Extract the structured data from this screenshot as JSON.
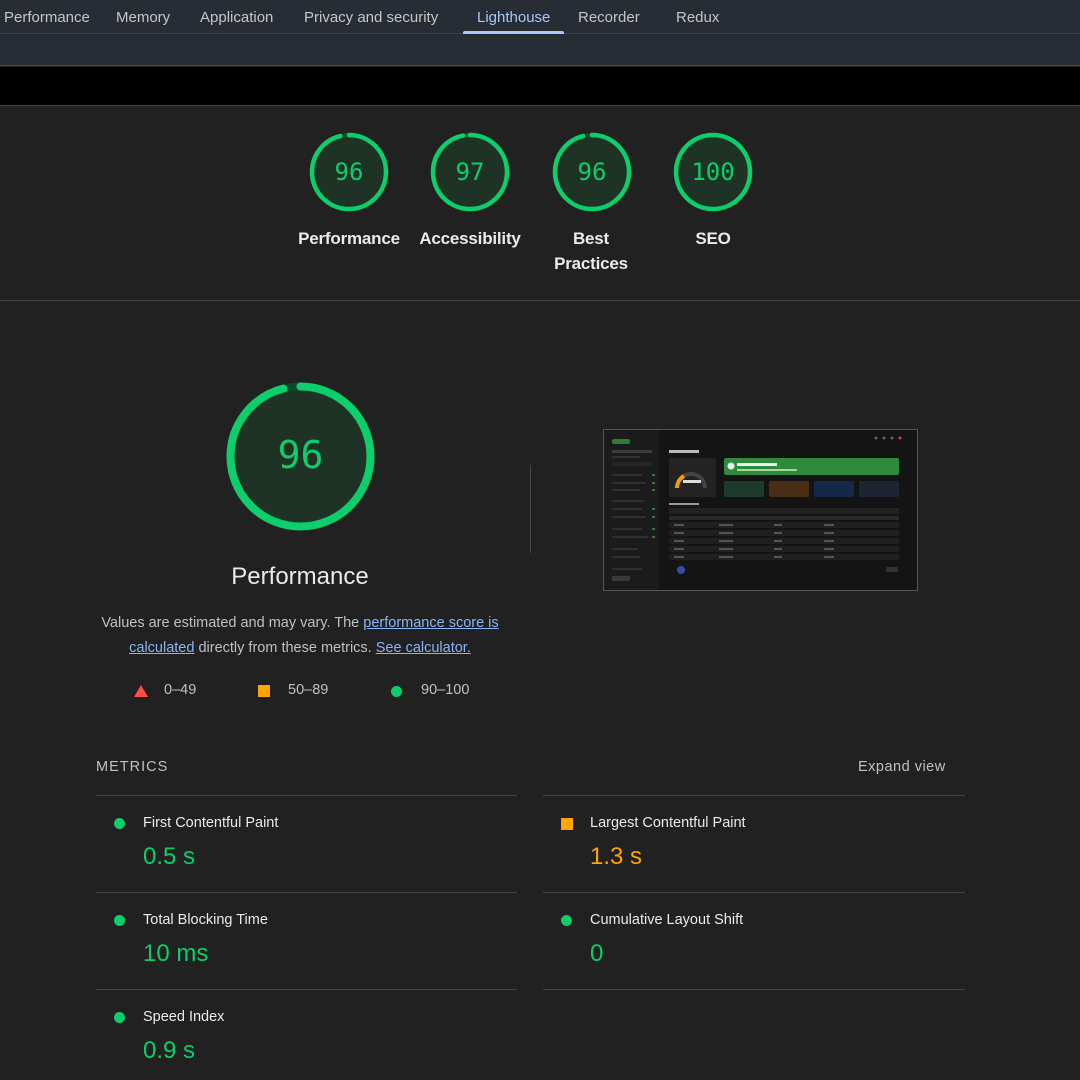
{
  "tabs": [
    {
      "label": "Performance",
      "active": false
    },
    {
      "label": "Memory",
      "active": false
    },
    {
      "label": "Application",
      "active": false
    },
    {
      "label": "Privacy and security",
      "active": false
    },
    {
      "label": "Lighthouse",
      "active": true
    },
    {
      "label": "Recorder",
      "active": false
    },
    {
      "label": "Redux",
      "active": false
    }
  ],
  "scores": [
    {
      "value": "96",
      "label": "Performance",
      "fraction": 0.96
    },
    {
      "value": "97",
      "label": "Accessibility",
      "fraction": 0.97
    },
    {
      "value": "96",
      "label": "Best Practices",
      "fraction": 0.96
    },
    {
      "value": "100",
      "label": "SEO",
      "fraction": 1.0
    }
  ],
  "performance": {
    "score": "96",
    "fraction": 0.96,
    "title": "Performance",
    "desc_prefix": "Values are estimated and may vary. The ",
    "desc_link1": "performance score is calculated",
    "desc_mid": " directly from these metrics. ",
    "desc_link2": "See calculator."
  },
  "legend": {
    "fail": "0–49",
    "average": "50–89",
    "pass": "90–100"
  },
  "metrics": {
    "heading": "METRICS",
    "expand": "Expand view",
    "items": [
      {
        "name": "First Contentful Paint",
        "value": "0.5 s",
        "status": "pass"
      },
      {
        "name": "Largest Contentful Paint",
        "value": "1.3 s",
        "status": "average"
      },
      {
        "name": "Total Blocking Time",
        "value": "10 ms",
        "status": "pass"
      },
      {
        "name": "Cumulative Layout Shift",
        "value": "0",
        "status": "pass"
      },
      {
        "name": "Speed Index",
        "value": "0.9 s",
        "status": "pass"
      }
    ]
  },
  "colors": {
    "pass": "#0cce6b",
    "average": "#ffa400",
    "fail": "#ff4e42",
    "active_tab": "#a8c7fa",
    "link": "#8ab4f8"
  }
}
